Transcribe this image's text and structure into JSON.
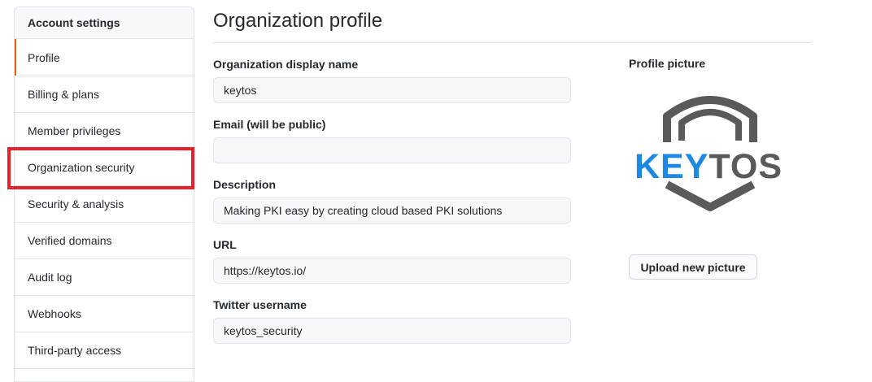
{
  "sidebar": {
    "header": "Account settings",
    "items": [
      {
        "label": "Profile"
      },
      {
        "label": "Billing & plans"
      },
      {
        "label": "Member privileges"
      },
      {
        "label": "Organization security"
      },
      {
        "label": "Security & analysis"
      },
      {
        "label": "Verified domains"
      },
      {
        "label": "Audit log"
      },
      {
        "label": "Webhooks"
      },
      {
        "label": "Third-party access"
      }
    ]
  },
  "main": {
    "title": "Organization profile",
    "fields": {
      "display_name": {
        "label": "Organization display name",
        "value": "keytos"
      },
      "email": {
        "label": "Email (will be public)",
        "value": ""
      },
      "description": {
        "label": "Description",
        "value": "Making PKI easy by creating cloud based PKI solutions"
      },
      "url": {
        "label": "URL",
        "value": "https://keytos.io/"
      },
      "twitter": {
        "label": "Twitter username",
        "value": "keytos_security"
      }
    }
  },
  "profile_picture": {
    "label": "Profile picture",
    "logo_text_blue": "KEY",
    "logo_text_gray": "TOS",
    "upload_button": "Upload new picture"
  },
  "colors": {
    "accent_orange": "#e36209",
    "highlight_red": "#e8202a",
    "logo_blue": "#1e88e5",
    "logo_gray": "#5a5a5a"
  }
}
